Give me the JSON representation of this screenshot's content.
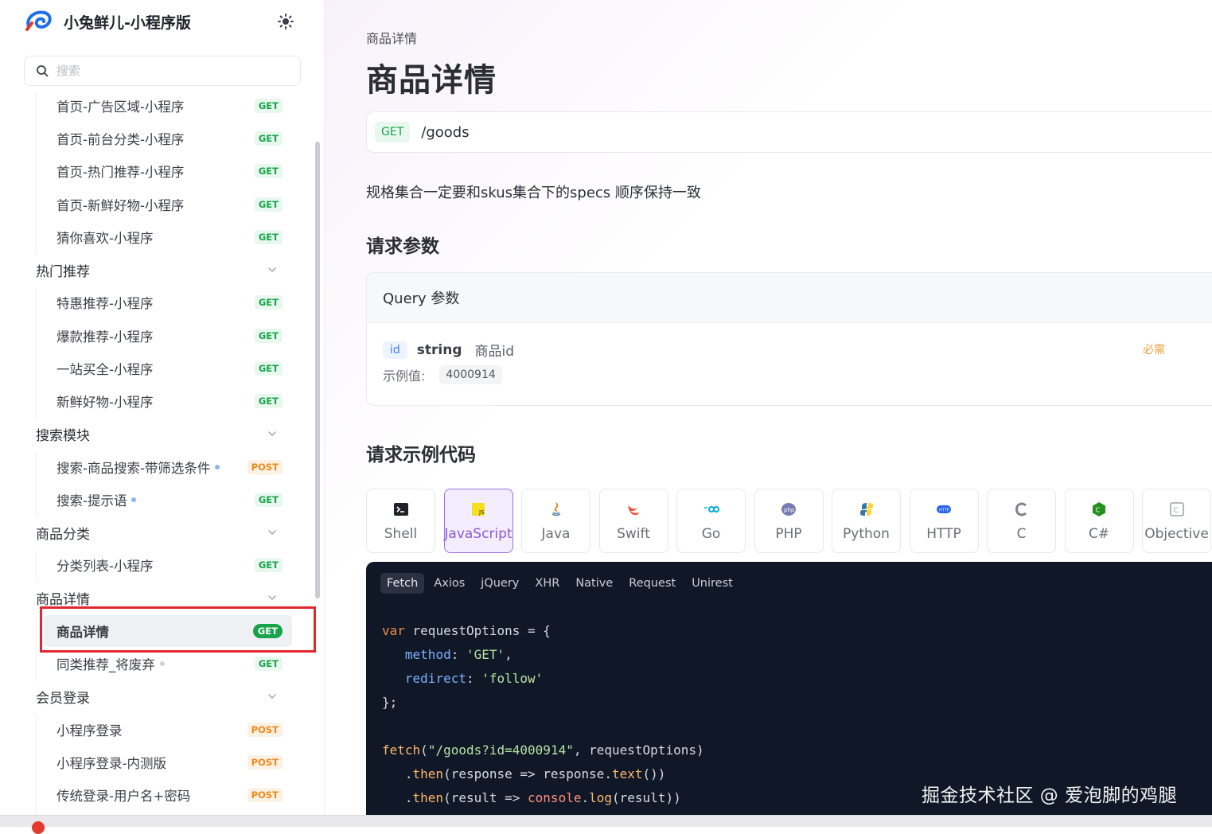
{
  "app": {
    "title": "小兔鲜儿-小程序版"
  },
  "search": {
    "placeholder": "搜索"
  },
  "sidebar": {
    "entries": [
      {
        "kind": "item",
        "label": "首页-广告区域-小程序",
        "method": "GET"
      },
      {
        "kind": "item",
        "label": "首页-前台分类-小程序",
        "method": "GET"
      },
      {
        "kind": "item",
        "label": "首页-热门推荐-小程序",
        "method": "GET"
      },
      {
        "kind": "item",
        "label": "首页-新鲜好物-小程序",
        "method": "GET"
      },
      {
        "kind": "item",
        "label": "猜你喜欢-小程序",
        "method": "GET"
      },
      {
        "kind": "group",
        "label": "热门推荐"
      },
      {
        "kind": "item",
        "label": "特惠推荐-小程序",
        "method": "GET"
      },
      {
        "kind": "item",
        "label": "爆款推荐-小程序",
        "method": "GET"
      },
      {
        "kind": "item",
        "label": "一站买全-小程序",
        "method": "GET"
      },
      {
        "kind": "item",
        "label": "新鲜好物-小程序",
        "method": "GET"
      },
      {
        "kind": "group",
        "label": "搜索模块"
      },
      {
        "kind": "item",
        "label": "搜索-商品搜索-带筛选条件",
        "method": "POST",
        "dot": "blue"
      },
      {
        "kind": "item",
        "label": "搜索-提示语",
        "method": "GET",
        "dot": "blue"
      },
      {
        "kind": "group",
        "label": "商品分类"
      },
      {
        "kind": "item",
        "label": "分类列表-小程序",
        "method": "GET"
      },
      {
        "kind": "group",
        "label": "商品详情"
      },
      {
        "kind": "item",
        "label": "商品详情",
        "method": "GET",
        "active": true
      },
      {
        "kind": "item",
        "label": "同类推荐_将废弃",
        "method": "GET",
        "dot": "grey"
      },
      {
        "kind": "group",
        "label": "会员登录"
      },
      {
        "kind": "item",
        "label": "小程序登录",
        "method": "POST"
      },
      {
        "kind": "item",
        "label": "小程序登录-内测版",
        "method": "POST"
      },
      {
        "kind": "item",
        "label": "传统登录-用户名+密码",
        "method": "POST"
      }
    ]
  },
  "main": {
    "breadcrumb": "商品详情",
    "title": "商品详情",
    "endpoint": {
      "method": "GET",
      "path": "/goods"
    },
    "description": "规格集合一定要和skus集合下的specs 顺序保持一致",
    "params_heading": "请求参数",
    "query": {
      "heading": "Query 参数",
      "param": {
        "name": "id",
        "type": "string",
        "desc": "商品id",
        "required": "必需"
      },
      "example_label": "示例值:",
      "example_value": "4000914"
    },
    "code_heading": "请求示例代码",
    "languages": [
      {
        "name": "Shell",
        "icon": "terminal-icon"
      },
      {
        "name": "JavaScript",
        "icon": "js-icon",
        "selected": true
      },
      {
        "name": "Java",
        "icon": "java-icon"
      },
      {
        "name": "Swift",
        "icon": "swift-icon"
      },
      {
        "name": "Go",
        "icon": "go-icon"
      },
      {
        "name": "PHP",
        "icon": "php-icon"
      },
      {
        "name": "Python",
        "icon": "python-icon"
      },
      {
        "name": "HTTP",
        "icon": "http-icon"
      },
      {
        "name": "C",
        "icon": "c-icon"
      },
      {
        "name": "C#",
        "icon": "csharp-icon"
      },
      {
        "name": "Objective",
        "icon": "objc-icon"
      }
    ],
    "code_tabs": [
      "Fetch",
      "Axios",
      "jQuery",
      "XHR",
      "Native",
      "Request",
      "Unirest"
    ],
    "active_code_tab": "Fetch",
    "code_lines": [
      "var requestOptions = {",
      "   method: 'GET',",
      "   redirect: 'follow'",
      "};",
      "",
      "fetch(\"/goods?id=4000914\", requestOptions)",
      "   .then(response => response.text())",
      "   .then(result => console.log(result))"
    ]
  },
  "watermark": "掘金技术社区 @ 爱泡脚的鸡腿",
  "colors": {
    "get": "#17a34a",
    "post": "#ea8a1d",
    "accent": "#8b5cd6",
    "highlight": "#e1262f",
    "code_bg": "#101828"
  }
}
